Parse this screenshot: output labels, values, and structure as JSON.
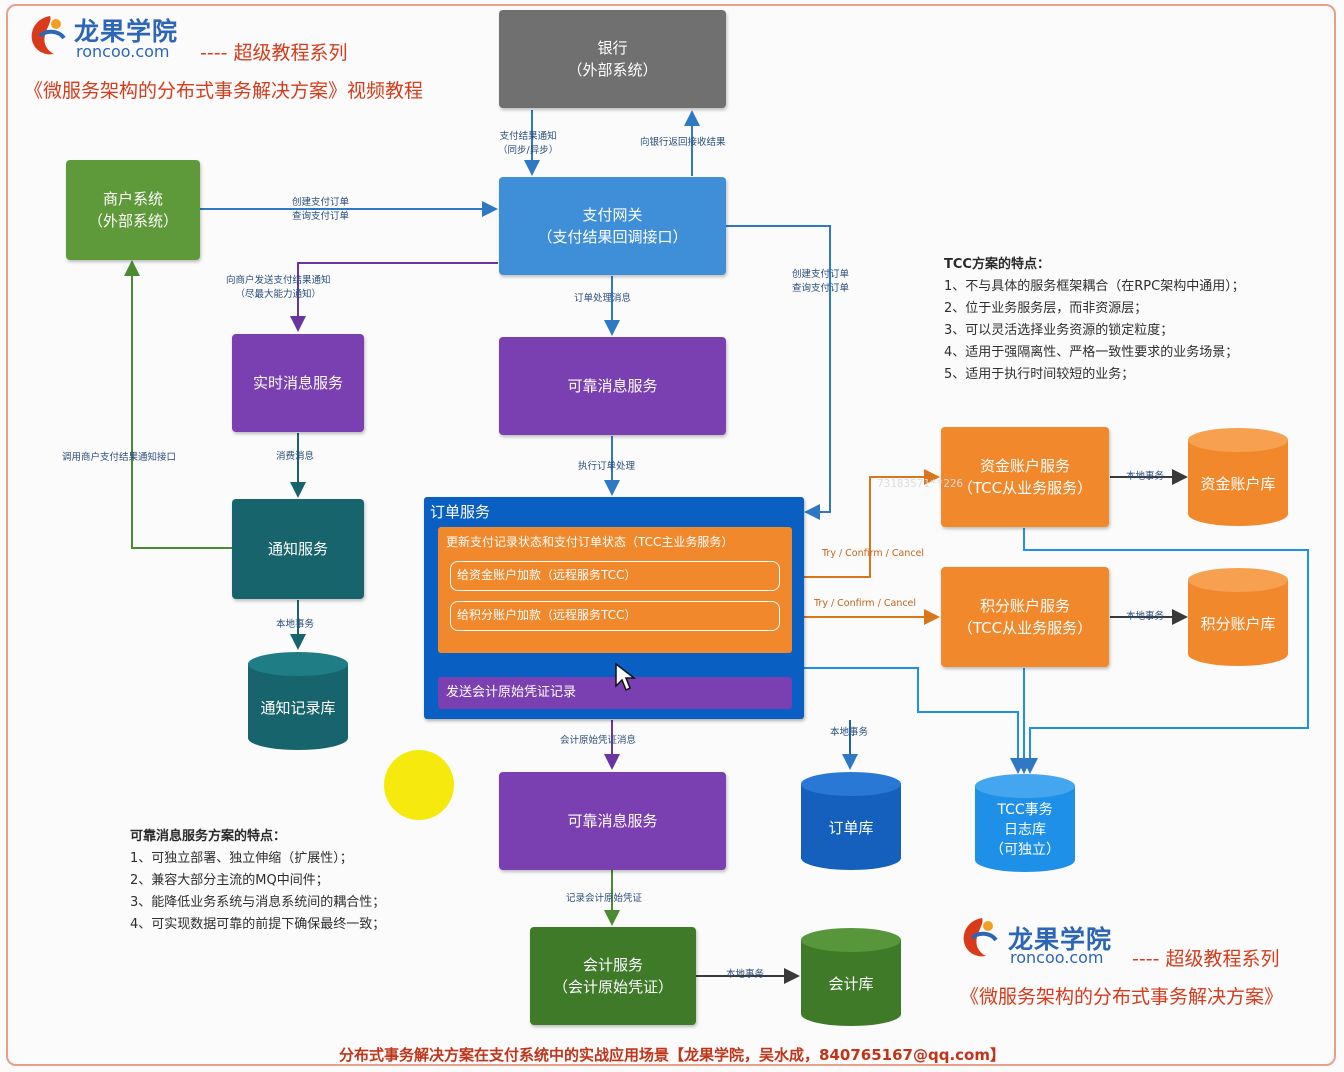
{
  "header": {
    "brand_name": "龙果学院",
    "brand_url": "roncoo.com",
    "series": "---- 超级教程系列",
    "course_title": "《微服务架构的分布式事务解决方案》视频教程"
  },
  "footer_brand": {
    "brand_name": "龙果学院",
    "brand_url": "roncoo.com",
    "series": "---- 超级教程系列",
    "course_title": "《微服务架构的分布式事务解决方案》"
  },
  "nodes": {
    "bank": [
      "银行",
      "（外部系统）"
    ],
    "merchant": [
      "商户系统",
      "（外部系统）"
    ],
    "gateway": [
      "支付网关",
      "（支付结果回调接口）"
    ],
    "realtime_msg": [
      "实时消息服务"
    ],
    "reliable_msg_1": [
      "可靠消息服务"
    ],
    "notify": [
      "通知服务"
    ],
    "notify_db": [
      "通知记录库"
    ],
    "fund_account": [
      "资金账户服务",
      "（TCC从业务服务）"
    ],
    "fund_db": [
      "资金账户库"
    ],
    "points_account": [
      "积分账户服务",
      "（TCC从业务服务）"
    ],
    "points_db": [
      "积分账户库"
    ],
    "reliable_msg_2": [
      "可靠消息服务"
    ],
    "order_db": [
      "订单库"
    ],
    "tcc_log_db": [
      "TCC事务",
      "日志库",
      "（可独立）"
    ],
    "accounting": [
      "会计服务",
      "（会计原始凭证）"
    ],
    "accounting_db": [
      "会计库"
    ]
  },
  "order_service": {
    "title": "订单服务",
    "main_task": "更新支付记录状态和支付订单状态（TCC主业务服务）",
    "sub_fund": "给资金账户加款（远程服务TCC）",
    "sub_points": "给积分账户加款（远程服务TCC）",
    "send_voucher": "发送会计原始凭证记录"
  },
  "edge_labels": {
    "pay_notify_1": "支付结果通知",
    "pay_notify_2": "（同步/异步）",
    "bank_return": "向银行返回接收结果",
    "create_order_1": "创建支付订单",
    "create_order_2": "查询支付订单",
    "merchant_notify_1": "向商户发送支付结果通知",
    "merchant_notify_2": "（尽最大能力通知）",
    "order_msg": "订单处理消息",
    "gateway_order_1": "创建支付订单",
    "gateway_order_2": "查询支付订单",
    "consume_msg": "消费消息",
    "exec_order": "执行订单处理",
    "call_merchant": "调用商户支付结果通知接口",
    "local_tx_notify": "本地事务",
    "tcc_fund": "Try / Confirm / Cancel",
    "tcc_points": "Try / Confirm / Cancel",
    "local_tx_fund": "本地事务",
    "local_tx_points": "本地事务",
    "acct_msg": "会计原始凭证消息",
    "local_tx_order": "本地事务",
    "record_voucher": "记录会计原始凭证",
    "local_tx_acct": "本地事务"
  },
  "tcc_notes": {
    "heading": "TCC方案的特点：",
    "items": [
      "1、不与具体的服务框架耦合（在RPC架构中通用）；",
      "2、位于业务服务层，而非资源层；",
      "3、可以灵活选择业务资源的锁定粒度；",
      "4、适用于强隔离性、严格一致性要求的业务场景；",
      "5、适用于执行时间较短的业务；"
    ]
  },
  "msg_notes": {
    "heading": "可靠消息服务方案的特点：",
    "items": [
      "1、可独立部署、独立伸缩（扩展性）；",
      "2、兼容大部分主流的MQ中间件；",
      "3、能降低业务系统与消息系统间的耦合性；",
      "4、可实现数据可靠的前提下确保最终一致；"
    ]
  },
  "footer_text": "分布式事务解决方案在支付系统中的实战应用场景【龙果学院，吴水成，840765167@qq.com】",
  "watermark": "73183571**226",
  "colors": {
    "gray": "#707070",
    "green": "#5e9a3a",
    "blue": "#3e8fd8",
    "purple": "#7a3fb0",
    "teal": "#17646c",
    "orange": "#f2882c",
    "order_blue": "#0a5fc2",
    "db_blue": "#1e90e8",
    "accent_red": "#d43c1c"
  }
}
